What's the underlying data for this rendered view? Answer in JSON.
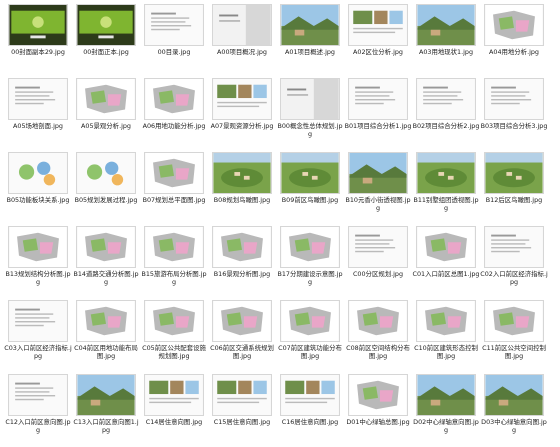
{
  "files": [
    {
      "name": "00封面副本29.jpg",
      "thumb": "cover-green"
    },
    {
      "name": "00封面正本.jpg",
      "thumb": "cover-green"
    },
    {
      "name": "00目录.jpg",
      "thumb": "doc"
    },
    {
      "name": "A00项目概况.jpg",
      "thumb": "doc-gray"
    },
    {
      "name": "A01项目概述.jpg",
      "thumb": "photo"
    },
    {
      "name": "A02区位分析.jpg",
      "thumb": "doc-photos"
    },
    {
      "name": "A03用地现状1.jpg",
      "thumb": "photo"
    },
    {
      "name": "A04用地分析.jpg",
      "thumb": "map-color"
    },
    {
      "name": "A05场地剖面.jpg",
      "thumb": "doc"
    },
    {
      "name": "A05景观分析.jpg",
      "thumb": "map-color"
    },
    {
      "name": "A06用地功能分析.jpg",
      "thumb": "map-color"
    },
    {
      "name": "A07景观资源分析.jpg",
      "thumb": "doc-photos"
    },
    {
      "name": "B00概念性总体规划.jpg",
      "thumb": "doc-gray"
    },
    {
      "name": "B01项目综合分析1.jpg",
      "thumb": "doc"
    },
    {
      "name": "B02项目综合分析2.jpg",
      "thumb": "doc"
    },
    {
      "name": "B03项目综合分析3.jpg",
      "thumb": "doc"
    },
    {
      "name": "B05功能板块关系.jpg",
      "thumb": "diagram"
    },
    {
      "name": "B05规划发展过程.jpg",
      "thumb": "diagram"
    },
    {
      "name": "B07规划总平面图.jpg",
      "thumb": "map-color"
    },
    {
      "name": "B08规划鸟瞰图.jpg",
      "thumb": "aerial"
    },
    {
      "name": "B09前区鸟瞰图.jpg",
      "thumb": "aerial"
    },
    {
      "name": "B10元香小街透视图.jpg",
      "thumb": "photo"
    },
    {
      "name": "B11别墅组团透视图.jpg",
      "thumb": "aerial"
    },
    {
      "name": "B12后区鸟瞰图.jpg",
      "thumb": "aerial"
    },
    {
      "name": "B13规划结构分析图.jpg",
      "thumb": "map-color"
    },
    {
      "name": "B14道路交通分析图.jpg",
      "thumb": "map-color"
    },
    {
      "name": "B15旅游布局分析图.jpg",
      "thumb": "map-color"
    },
    {
      "name": "B16景观分析图.jpg",
      "thumb": "map-color"
    },
    {
      "name": "B17分期建设示意图.jpg",
      "thumb": "map-color"
    },
    {
      "name": "C00分区规划.jpg",
      "thumb": "doc"
    },
    {
      "name": "C01入口前区总图1.jpg",
      "thumb": "map-color"
    },
    {
      "name": "C02入口前区经济指标.jpg",
      "thumb": "doc"
    },
    {
      "name": "C03入口前区经济指标.jpg",
      "thumb": "doc"
    },
    {
      "name": "C04前区用地功能布局图.jpg",
      "thumb": "map-color"
    },
    {
      "name": "C05前区公共配套设施规划图.jpg",
      "thumb": "map-color"
    },
    {
      "name": "C06前区交通系统规划图.jpg",
      "thumb": "map-color"
    },
    {
      "name": "C07前区建筑功能分布图.jpg",
      "thumb": "map-color"
    },
    {
      "name": "C08前区空间结构分布图.jpg",
      "thumb": "map-color"
    },
    {
      "name": "C10前区建筑形态控制图.jpg",
      "thumb": "map-color"
    },
    {
      "name": "C11前区公共空间控制图.jpg",
      "thumb": "map-color"
    },
    {
      "name": "C12入口前区意向图.jpg",
      "thumb": "doc"
    },
    {
      "name": "C13入口前区意向图1.jpg",
      "thumb": "photo"
    },
    {
      "name": "C14居住意向图.jpg",
      "thumb": "doc-photos"
    },
    {
      "name": "C15居住意向图.jpg",
      "thumb": "doc-photos"
    },
    {
      "name": "C16居住意向图.jpg",
      "thumb": "doc-photos"
    },
    {
      "name": "D01中心绿轴总图.jpg",
      "thumb": "map-color"
    },
    {
      "name": "D02中心绿轴意向图.jpg",
      "thumb": "photo"
    },
    {
      "name": "D03中心绿轴意向图.jpg",
      "thumb": "photo"
    }
  ],
  "colors": {
    "label_text": "#222222",
    "cover_green": "#7fb530",
    "map_green": "#8ab965",
    "map_pink": "#e9a6c8",
    "map_gray": "#b9b9b9",
    "photo_sky": "#9cc6e6",
    "photo_ground": "#6f8f4a"
  }
}
